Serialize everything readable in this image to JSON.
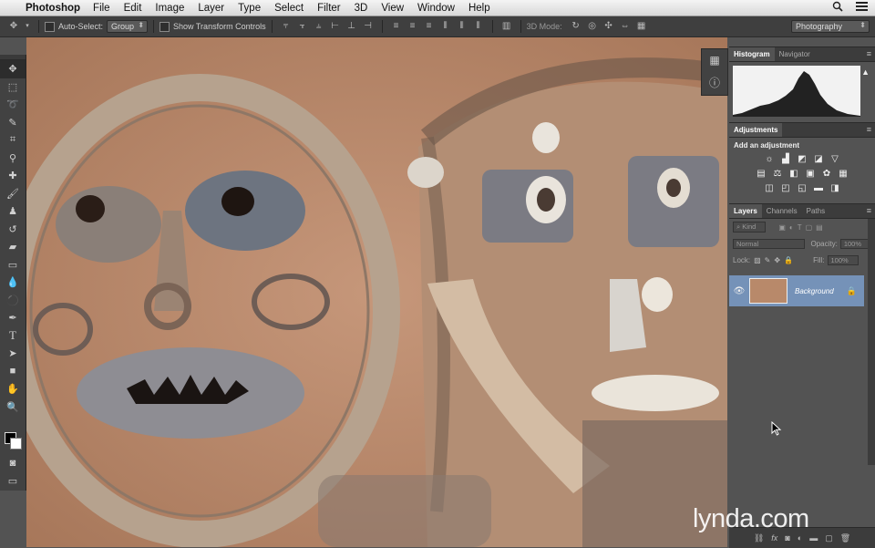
{
  "menubar": {
    "app_name": "Photoshop",
    "items": [
      "File",
      "Edit",
      "Image",
      "Layer",
      "Type",
      "Select",
      "Filter",
      "3D",
      "View",
      "Window",
      "Help"
    ]
  },
  "options_bar": {
    "auto_select_label": "Auto-Select:",
    "auto_select_value": "Group",
    "show_transform_label": "Show Transform Controls",
    "mode_3d_label": "3D Mode:",
    "workspace_value": "Photography"
  },
  "panels": {
    "top_tabs": [
      "Histogram",
      "Navigator"
    ],
    "adjustments_tab": "Adjustments",
    "adjustments_hint": "Add an adjustment",
    "layer_tabs": [
      "Layers",
      "Channels",
      "Paths"
    ],
    "filter_kind": "Kind",
    "blend_mode": "Normal",
    "opacity_label": "Opacity:",
    "opacity_value": "100%",
    "lock_label": "Lock:",
    "fill_label": "Fill:",
    "fill_value": "100%",
    "layer_name": "Background"
  },
  "watermark": "lynda.com",
  "icons": {
    "apple": "apple-icon",
    "search": "search-icon",
    "list": "list-icon",
    "move_tool": "move-tool-icon",
    "lock": "lock-icon",
    "eye": "eye-icon",
    "warning": "warning-icon",
    "info": "info-icon"
  }
}
